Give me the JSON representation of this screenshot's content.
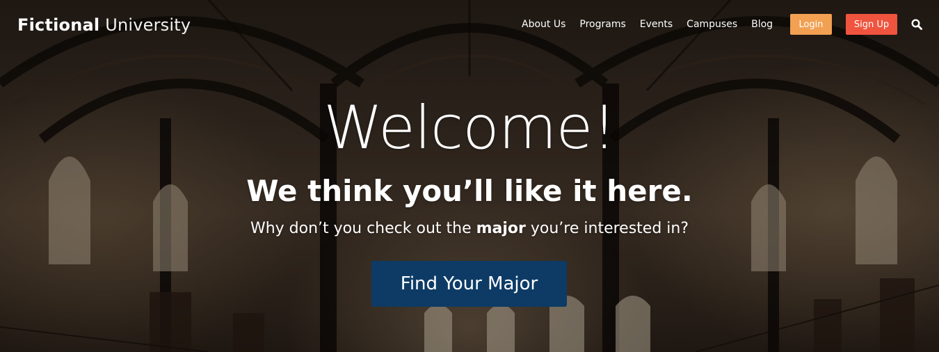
{
  "header": {
    "logo_bold": "Fictional",
    "logo_light": "University",
    "nav": [
      {
        "label": "About Us"
      },
      {
        "label": "Programs"
      },
      {
        "label": "Events"
      },
      {
        "label": "Campuses"
      },
      {
        "label": "Blog"
      }
    ],
    "login_label": "Login",
    "signup_label": "Sign Up",
    "search_icon": "search-icon"
  },
  "hero": {
    "headline": "Welcome!",
    "subheadline": "We think you’ll like it here.",
    "tagline_before": "Why don’t you check out the ",
    "tagline_bold": "major",
    "tagline_after": " you’re interested in?",
    "cta_label": "Find Your Major"
  },
  "colors": {
    "login": "#f2a052",
    "signup": "#f0543e",
    "cta": "#0d3b66"
  }
}
